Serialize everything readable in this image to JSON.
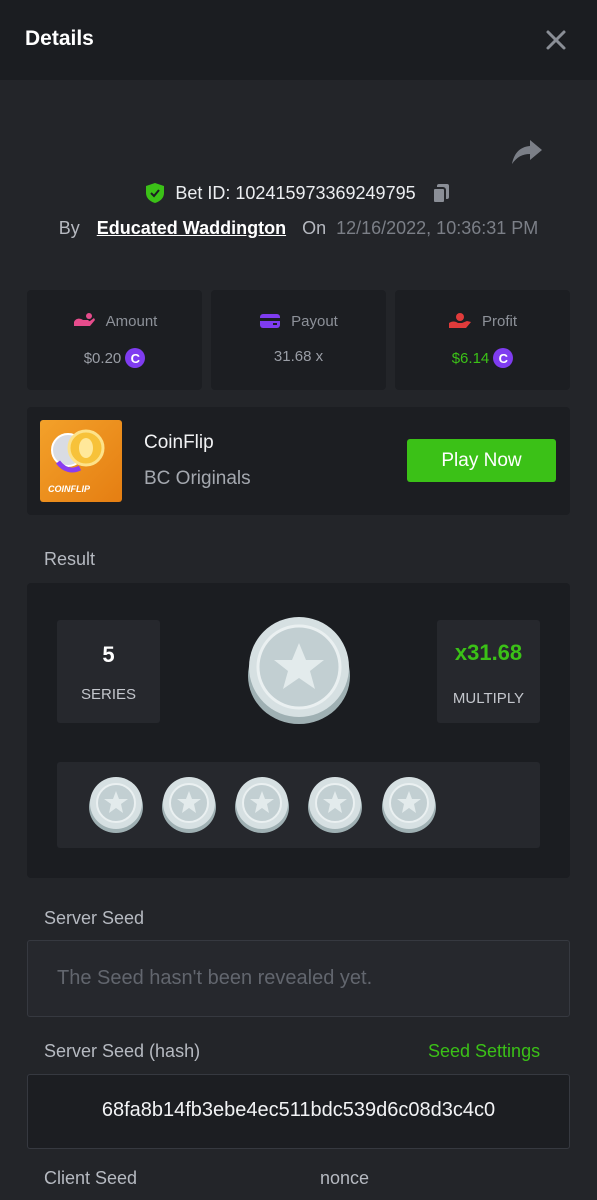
{
  "header": {
    "title": "Details"
  },
  "bet": {
    "id_text": "Bet ID: 102415973369249795",
    "by_label": "By",
    "username": "Educated Waddington",
    "on_label": "On",
    "date": "12/16/2022, 10:36:31 PM"
  },
  "stats": {
    "amount": {
      "label": "Amount",
      "value": "$0.20",
      "currency_icon": "C",
      "color": "#9a9ea6"
    },
    "payout": {
      "label": "Payout",
      "value": "31.68 x",
      "color": "#9a9ea6"
    },
    "profit": {
      "label": "Profit",
      "value": "$6.14",
      "currency_icon": "C",
      "color": "#3bc117"
    }
  },
  "game": {
    "thumbnail_label": "COINFLIP",
    "name": "CoinFlip",
    "provider": "BC Originals",
    "play_label": "Play Now"
  },
  "result": {
    "label": "Result",
    "series_value": "5",
    "series_label": "SERIES",
    "multiplier_value": "31.68",
    "multiplier_prefix_icon": "x",
    "multiplier_label": "MULTIPLY",
    "coin_faces": [
      "star",
      "star",
      "star",
      "star",
      "star"
    ]
  },
  "server_seed": {
    "label": "Server Seed",
    "placeholder": "The Seed hasn't been revealed yet."
  },
  "server_seed_hash": {
    "label": "Server Seed (hash)",
    "settings_link": "Seed Settings",
    "value": "68fa8b14fb3ebe4ec511bdc539d6c08d3c4c0"
  },
  "client_seed": {
    "label": "Client Seed",
    "nonce_label": "nonce"
  },
  "colors": {
    "accent_green": "#3bc117",
    "currency_purple": "#7f3cf0",
    "background": "#232529"
  }
}
